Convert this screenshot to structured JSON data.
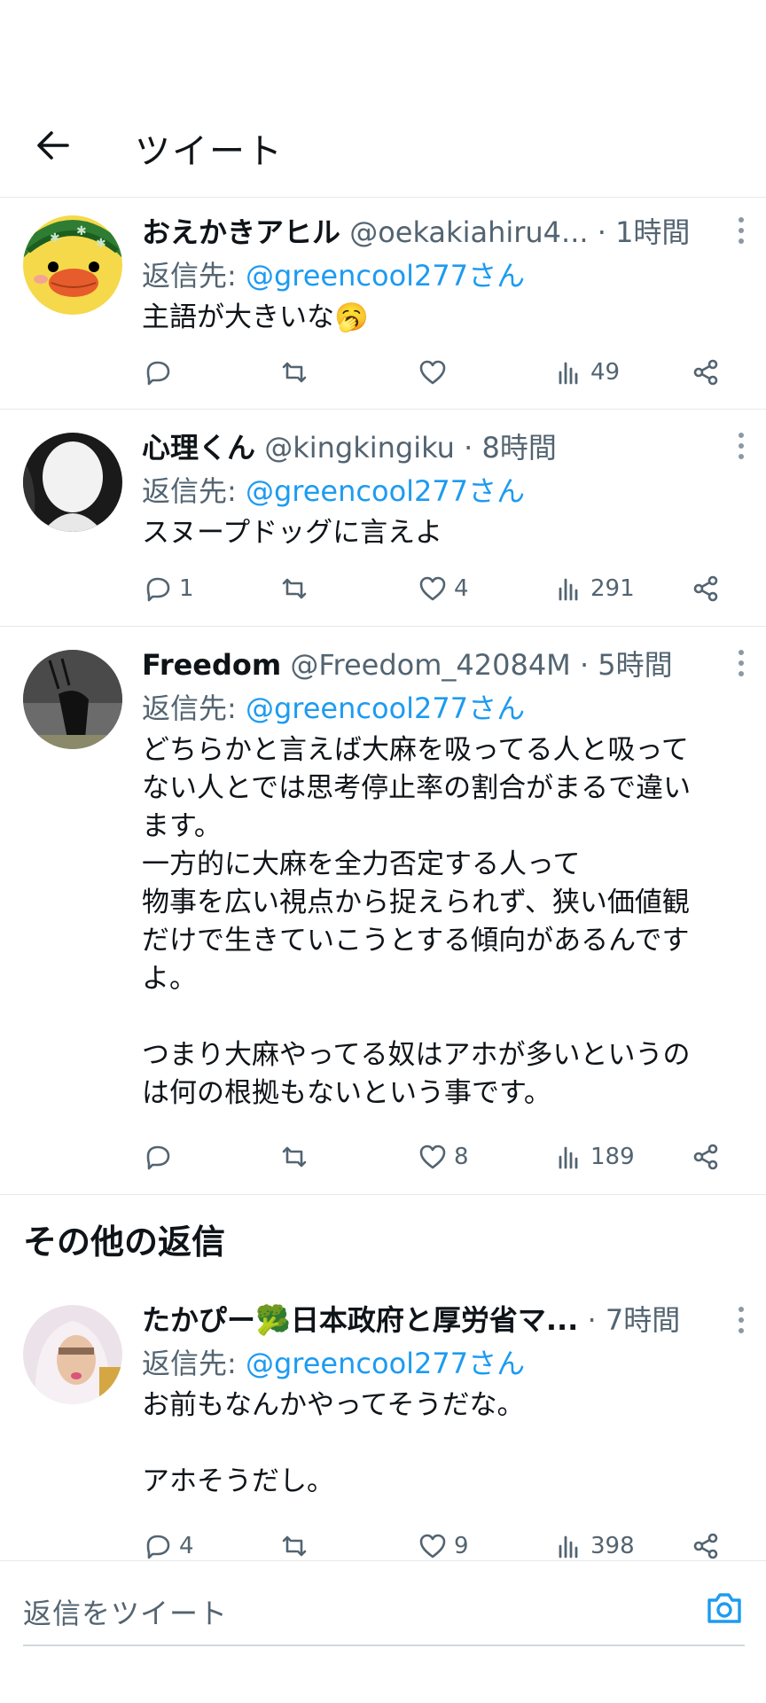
{
  "header": {
    "title": "ツイート"
  },
  "tweets": [
    {
      "name": "おえかきアヒル",
      "handle": "@oekakiahiru4...",
      "time": "1時間",
      "reply_label": "返信先:",
      "reply_to": "@greencool277さん",
      "text": "主語が大きいな🥱",
      "counts": {
        "reply": "",
        "retweet": "",
        "like": "",
        "views": "49"
      }
    },
    {
      "name": "心理くん",
      "handle": "@kingkingiku",
      "time": "8時間",
      "reply_label": "返信先:",
      "reply_to": "@greencool277さん",
      "text": "スヌープドッグに言えよ",
      "counts": {
        "reply": "1",
        "retweet": "",
        "like": "4",
        "views": "291"
      }
    },
    {
      "name": "Freedom",
      "handle": "@Freedom_42084M",
      "time": "5時間",
      "reply_label": "返信先:",
      "reply_to": "@greencool277さん",
      "text": "どちらかと言えば大麻を吸ってる人と吸って\nない人とでは思考停止率の割合がまるで違い\nます。\n一方的に大麻を全力否定する人って\n物事を広い視点から捉えられず、狭い価値観\nだけで生きていこうとする傾向があるんです\nよ。\n\nつまり大麻やってる奴はアホが多いというの\nは何の根拠もないという事です。",
      "counts": {
        "reply": "",
        "retweet": "",
        "like": "8",
        "views": "189"
      }
    },
    {
      "name": "たかぴー🥦日本政府と厚労省マ...",
      "handle": "",
      "time": "7時間",
      "reply_label": "返信先:",
      "reply_to": "@greencool277さん",
      "text": "お前もなんかやってそうだな。\n\nアホそうだし。",
      "counts": {
        "reply": "4",
        "retweet": "",
        "like": "9",
        "views": "398"
      }
    }
  ],
  "other_replies_title": "その他の返信",
  "compose": {
    "placeholder": "返信をツイート"
  },
  "colors": {
    "accent": "#1d9bf0",
    "secondary_text": "#536471",
    "divider": "#e6e9eb"
  }
}
